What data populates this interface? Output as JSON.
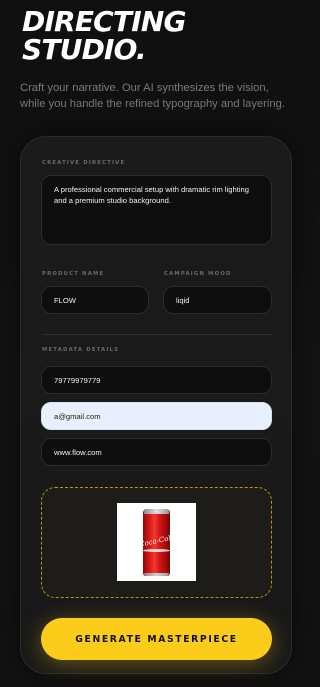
{
  "header": {
    "title_line1": "DIRECTING",
    "title_line2": "STUDIO.",
    "subtitle": "Craft your narrative. Our AI synthesizes the vision, while you handle the refined typography and layering."
  },
  "form": {
    "creative_directive": {
      "label": "CREATIVE DIRECTIVE",
      "value": "A professional commercial setup with dramatic rim lighting and a premium studio background."
    },
    "product_name": {
      "label": "PRODUCT NAME",
      "value": "FLOW"
    },
    "campaign_mood": {
      "label": "CAMPAIGN MOOD",
      "value": "liqid"
    },
    "metadata": {
      "label": "METADATA DETAILS",
      "phone": "79779979779",
      "email": "a@gmail.com",
      "website": "www.flow.com"
    },
    "upload": {
      "preview_icon": "product-image"
    },
    "generate_label": "GENERATE MASTERPIECE"
  },
  "colors": {
    "accent": "#fccc1a",
    "background": "#121212",
    "card": "#1a1a1a",
    "autofill": "#e8f0fe"
  }
}
